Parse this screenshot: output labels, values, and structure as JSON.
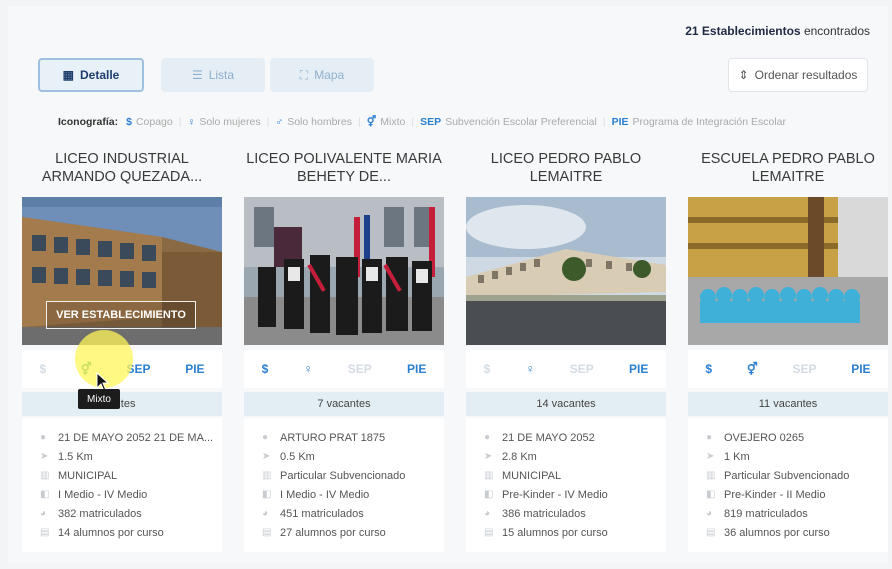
{
  "header": {
    "count": "21 Establecimientos",
    "count_suffix": "encontrados"
  },
  "toolbar": {
    "detalle": "Detalle",
    "lista": "Lista",
    "mapa": "Mapa",
    "sort": "Ordenar resultados"
  },
  "legend": {
    "label": "Iconografía:",
    "items": [
      {
        "sym": "$",
        "text": "Copago"
      },
      {
        "sym": "♀",
        "text": "Solo mujeres"
      },
      {
        "sym": "♂",
        "text": "Solo hombres"
      },
      {
        "sym": "⚥",
        "text": "Mixto"
      },
      {
        "sym": "SEP",
        "text": "Subvención Escolar Preferencial"
      },
      {
        "sym": "PIE",
        "text": "Programa de Integración Escolar"
      }
    ]
  },
  "cards": [
    {
      "title": "LICEO INDUSTRIAL ARMANDO QUEZADA...",
      "ver": "VER ESTABLECIMIENTO",
      "vacantes": "antes",
      "address": "21 DE MAYO 2052 21 DE MA...",
      "distance": "1.5 Km",
      "dependencia": "MUNICIPAL",
      "niveles": "I Medio - IV Medio",
      "matriculados": "382 matriculados",
      "por_curso": "14 alumnos por curso"
    },
    {
      "title": "LICEO POLIVALENTE MARIA BEHETY DE...",
      "vacantes": "7 vacantes",
      "address": "ARTURO PRAT 1875",
      "distance": "0.5 Km",
      "dependencia": "Particular Subvencionado",
      "niveles": "I Medio - IV Medio",
      "matriculados": "451 matriculados",
      "por_curso": "27 alumnos por curso"
    },
    {
      "title": "LICEO PEDRO PABLO LEMAITRE",
      "vacantes": "14 vacantes",
      "address": "21 DE MAYO 2052",
      "distance": "2.8 Km",
      "dependencia": "MUNICIPAL",
      "niveles": "Pre-Kinder - IV Medio",
      "matriculados": "386 matriculados",
      "por_curso": "15 alumnos por curso"
    },
    {
      "title": "ESCUELA PEDRO PABLO LEMAITRE",
      "vacantes": "11 vacantes",
      "address": "OVEJERO 0265",
      "distance": "1 Km",
      "dependencia": "Particular Subvencionado",
      "niveles": "Pre-Kinder - II Medio",
      "matriculados": "819 matriculados",
      "por_curso": "36 alumnos por curso"
    }
  ],
  "icon_labels": {
    "dollar": "$",
    "sep": "SEP",
    "pie": "PIE",
    "mixto_sym": "⚥",
    "mujer_sym": "♀"
  },
  "tooltip": "Mixto",
  "colors": {
    "accent": "#2b7fd0",
    "mixto_green": "#2a9d6f",
    "vac_bg": "#e3eef4"
  }
}
